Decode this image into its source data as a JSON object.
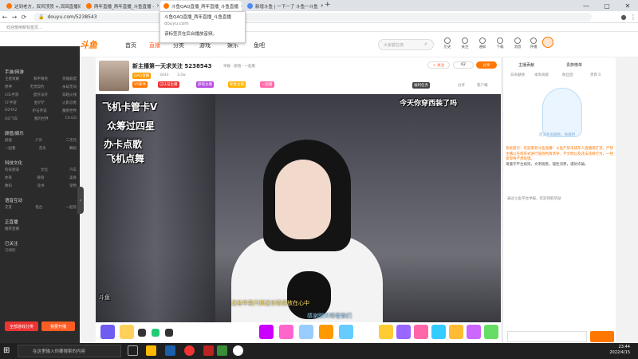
{
  "browser": {
    "tabs": [
      {
        "label": "达到老方，双风顶顶 +,百回直播间 -"
      },
      {
        "label": "两年直播_两年直播_斗鱼直播 -"
      },
      {
        "label": "斗鱼QAQ直播_两年直播_斗鱼直播"
      },
      {
        "label": "新增斗鱼 | 一下一了 斗鱼一斗鱼"
      }
    ],
    "active_tab_index": 2,
    "new_tab": "+",
    "url": "douyu.com/5238543",
    "bookmarks_text": "欢迎使用新标签页…",
    "tooltip": {
      "title": "斗鱼QAQ直播_两年直播_斗鱼直播",
      "domain": "douyu.com",
      "note": "该标签页在后台播放音频。"
    },
    "window_controls": {
      "minimize": "—",
      "maximize": "▢",
      "close": "✕"
    }
  },
  "site": {
    "logo": "斗鱼",
    "nav": [
      "首页",
      "直播",
      "分类",
      "游戏",
      "娱乐",
      "鱼吧"
    ],
    "nav_active": 1,
    "search_placeholder": "大家都在搜",
    "header_icons": [
      "历史",
      "关注",
      "通知",
      "下载",
      "消息",
      "开播"
    ]
  },
  "sidebar": {
    "sections": [
      {
        "title": "手游/网游",
        "rows": [
          [
            "王者荣耀",
            "和平精英",
            "英雄联盟"
          ],
          [
            "原神",
            "无畏契约",
            "永劫无间"
          ],
          [
            "LOL手游",
            "蛋仔派对",
            "穿越火线"
          ],
          [
            "CF手游",
            "金铲铲",
            "火影忍者"
          ],
          [
            "DOTA2",
            "炉石传说",
            "魔兽世界"
          ],
          [
            "QQ飞车",
            "我的世界",
            "CS:GO"
          ]
        ]
      },
      {
        "title": "颜值/娱乐",
        "rows": [
          [
            "颜值",
            "户外",
            "二次元"
          ],
          [
            "一起看",
            "音乐",
            "舞蹈"
          ]
        ]
      },
      {
        "title": "科技文化",
        "rows": [
          [
            "科技频道",
            "文化",
            "汽车"
          ],
          [
            "体育",
            "教育",
            "美食"
          ],
          [
            "数码",
            "读书",
            "宠物"
          ]
        ]
      },
      {
        "title": "语音互动",
        "rows": [
          [
            "交友",
            "电台",
            "一起玩"
          ]
        ]
      },
      {
        "title": "正直播",
        "rows": [
          [
            "推荐直播",
            "",
            ""
          ]
        ]
      },
      {
        "title": "已关注",
        "rows": [
          [
            "订阅的",
            "",
            ""
          ]
        ]
      }
    ],
    "btn_left": "全部游戏分类",
    "btn_right": "我要开播",
    "collapse": "‹"
  },
  "room": {
    "title": "新主播第一天求关注 5238543",
    "meta": "举报 · 颜值 · 一起看",
    "anchor_tag": "QAQ直播",
    "fans": "3443",
    "followers": "3.5w",
    "badges": [
      "V5新秀",
      "已认证主播",
      "颜值主播",
      "新星主播",
      "一起看"
    ],
    "actions": {
      "follow": "+ 关注",
      "count": "62",
      "share": "分享"
    },
    "top_right": [
      "福利任务",
      "分享",
      "客户端"
    ]
  },
  "video": {
    "overlay": [
      "飞机卡管卡V",
      "众筹过四星",
      "办卡点歌",
      "飞机点舞",
      "今天你穿西装了吗"
    ],
    "danmaku": [
      "这些年我只把这份情感放在心中",
      "感谢聊天呀老铁们"
    ],
    "watermark": "斗鱼"
  },
  "right_panel": {
    "tabs": [
      "主播贡献",
      "贵族榜单"
    ],
    "sub": [
      "日贡献榜",
      "本周贡献",
      "粉丝团",
      "贵宾 0"
    ],
    "mascot_caption": "还没有贡献榜，快来吧",
    "chat": [
      "系统提示：欢迎来到斗鱼直播！斗鱼严禁未成年人直播或打赏，严禁主播以任何形式进行低俗色情诱导、不文明以及违法违规行为，一经发现将严肃处理。",
      "请遵守平台规则，文明观看，理性消费，谨防诈骗。"
    ],
    "chat_foot": "通过斗鱼平台举报，欢迎领取奖励"
  },
  "taskbar": {
    "search_placeholder": "在这里输入你要搜索的内容",
    "time": "23:44",
    "date": "2022/4/15"
  }
}
